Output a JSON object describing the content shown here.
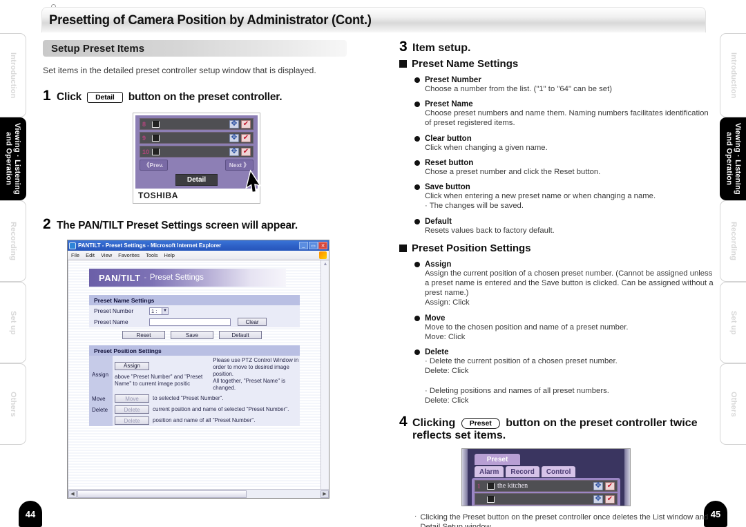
{
  "header": {
    "title": "Presetting of Camera Position by Administrator (Cont.)"
  },
  "sidebar": {
    "items": [
      {
        "label": "Introduction",
        "active": false
      },
      {
        "label": "Viewing · Listening\nand Operation",
        "active": true
      },
      {
        "label": "Recording",
        "active": false
      },
      {
        "label": "Set up",
        "active": false
      },
      {
        "label": "Others",
        "active": false
      }
    ],
    "page_left": "44",
    "page_right": "45"
  },
  "left_column": {
    "section_title": "Setup Preset Items",
    "lead": "Set items in the detailed preset controller setup window that is displayed.",
    "step1": {
      "number": "1",
      "text_before": "Click",
      "button_label": "Detail",
      "text_after": "button on the preset controller."
    },
    "preset_controller": {
      "rows": [
        {
          "number": "8",
          "name": ""
        },
        {
          "number": "9",
          "name": ""
        },
        {
          "number": "10",
          "name": ""
        }
      ],
      "prev_label": "《Prev.",
      "next_label": "Next 》",
      "detail_label": "Detail",
      "brand": "TOSHIBA",
      "icons": {
        "move": "move-icon",
        "check": "check-icon",
        "thumb": "thumbnail-icon"
      }
    },
    "step2": {
      "number": "2",
      "text": "The PAN/TILT Preset Settings screen will appear."
    },
    "browser": {
      "title": "PANTILT - Preset Settings - Microsoft Internet Explorer",
      "menu": [
        "File",
        "Edit",
        "View",
        "Favorites",
        "Tools",
        "Help"
      ],
      "window_buttons": [
        "minimize",
        "maximize",
        "close"
      ],
      "banner_main": "PAN/TILT",
      "banner_dash": "-",
      "banner_sub": "Preset Settings",
      "name_settings": {
        "heading": "Preset Name Settings",
        "preset_number_label": "Preset Number",
        "preset_number_value": "1 :",
        "preset_name_label": "Preset Name",
        "preset_name_value": "",
        "clear_label": "Clear",
        "reset_label": "Reset",
        "save_label": "Save",
        "default_label": "Default"
      },
      "position_settings": {
        "heading": "Preset Position Settings",
        "rows": [
          {
            "label": "Assign",
            "button": "Assign",
            "button_enabled": true,
            "text": "above \"Preset Number\" and \"Preset Name\" to current image positic",
            "extra": "Please use PTZ Control Window in order to move to desired image position.\nAll together, \"Preset Name\" is changed."
          },
          {
            "label": "Move",
            "button": "Move",
            "button_enabled": false,
            "text": "to selected \"Preset Number\".",
            "extra": ""
          },
          {
            "label": "Delete",
            "button": "Delete",
            "button_enabled": false,
            "text": "current position and name of selected \"Preset Number\".",
            "extra": ""
          },
          {
            "label": "",
            "button": "Delete",
            "button_enabled": false,
            "text": "position and name of all \"Preset Number\".",
            "extra": ""
          }
        ]
      }
    }
  },
  "right_column": {
    "step3": {
      "number": "3",
      "text": "Item setup."
    },
    "group1": {
      "heading": "Preset Name Settings",
      "items": [
        {
          "title": "Preset Number",
          "body": "Choose a number from the list.  (\"1\" to \"64\" can be set)"
        },
        {
          "title": "Preset Name",
          "body": "Choose preset numbers and name them.  Naming numbers facilitates identification of preset registered items."
        },
        {
          "title": "Clear button",
          "body": "Click when changing a given name."
        },
        {
          "title": "Reset button",
          "body": "Chose a preset number and click the Reset button."
        },
        {
          "title": "Save button",
          "body": "Click when entering a new preset name or when changing a name.\n· The changes will be saved."
        },
        {
          "title": "Default",
          "body": "Resets values back to factory default."
        }
      ]
    },
    "group2": {
      "heading": "Preset Position Settings",
      "items": [
        {
          "title": "Assign",
          "body": "Assign the current position of a chosen preset number.  (Cannot be assigned unless a preset name is entered and the Save button is clicked. Can be assigned without a prest name.)\nAssign: Click"
        },
        {
          "title": "Move",
          "body": "Move to the chosen position and name of a preset number.\nMove: Click"
        },
        {
          "title": "Delete",
          "body": "· Delete the current position of a chosen preset number.\n  Delete: Click\n\n· Deleting positions and names of all preset numbers.\n  Delete: Click"
        }
      ]
    },
    "step4": {
      "number": "4",
      "text_before": "Clicking",
      "button_label": "Preset",
      "text_after": "button on the preset controller twice",
      "text_line2": "reflects set items."
    },
    "controller4": {
      "preset_tag": "Preset",
      "tabs": [
        "Alarm",
        "Record",
        "Control"
      ],
      "rows": [
        {
          "number": "1",
          "name": "the kitchen"
        },
        {
          "number": "",
          "name": ""
        }
      ]
    },
    "note": {
      "mark": "·",
      "text": "Clicking the Preset button on the preset controller once deletes the List window and Detail Setup window."
    }
  }
}
